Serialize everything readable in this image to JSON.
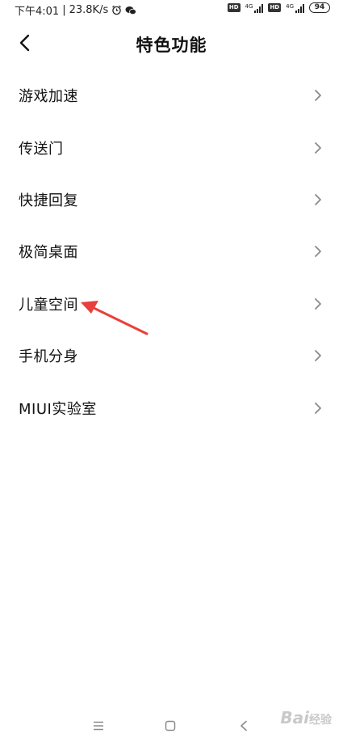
{
  "status_bar": {
    "time": "下午4:01",
    "speed": "23.8K/s",
    "hd_label": "HD",
    "network_label": "4G",
    "battery": "94"
  },
  "header": {
    "title": "特色功能"
  },
  "menu": {
    "items": [
      {
        "label": "游戏加速"
      },
      {
        "label": "传送门"
      },
      {
        "label": "快捷回复"
      },
      {
        "label": "极简桌面"
      },
      {
        "label": "儿童空间"
      },
      {
        "label": "手机分身"
      },
      {
        "label": "MIUI实验室"
      }
    ]
  },
  "watermark": {
    "brand": "Bai",
    "suffix": "经验"
  },
  "icons": {
    "back": "chevron-left-icon",
    "item_arrow": "chevron-right-icon",
    "alarm": "alarm-icon",
    "wechat": "wechat-icon",
    "annotation": "red-arrow-annotation",
    "nav_menu": "menu-icon",
    "nav_home": "home-square-icon",
    "nav_back": "back-icon"
  },
  "colors": {
    "background": "#ffffff",
    "text": "#111111",
    "chevron": "#8a8a8a",
    "annotation_arrow": "#e8403a"
  }
}
